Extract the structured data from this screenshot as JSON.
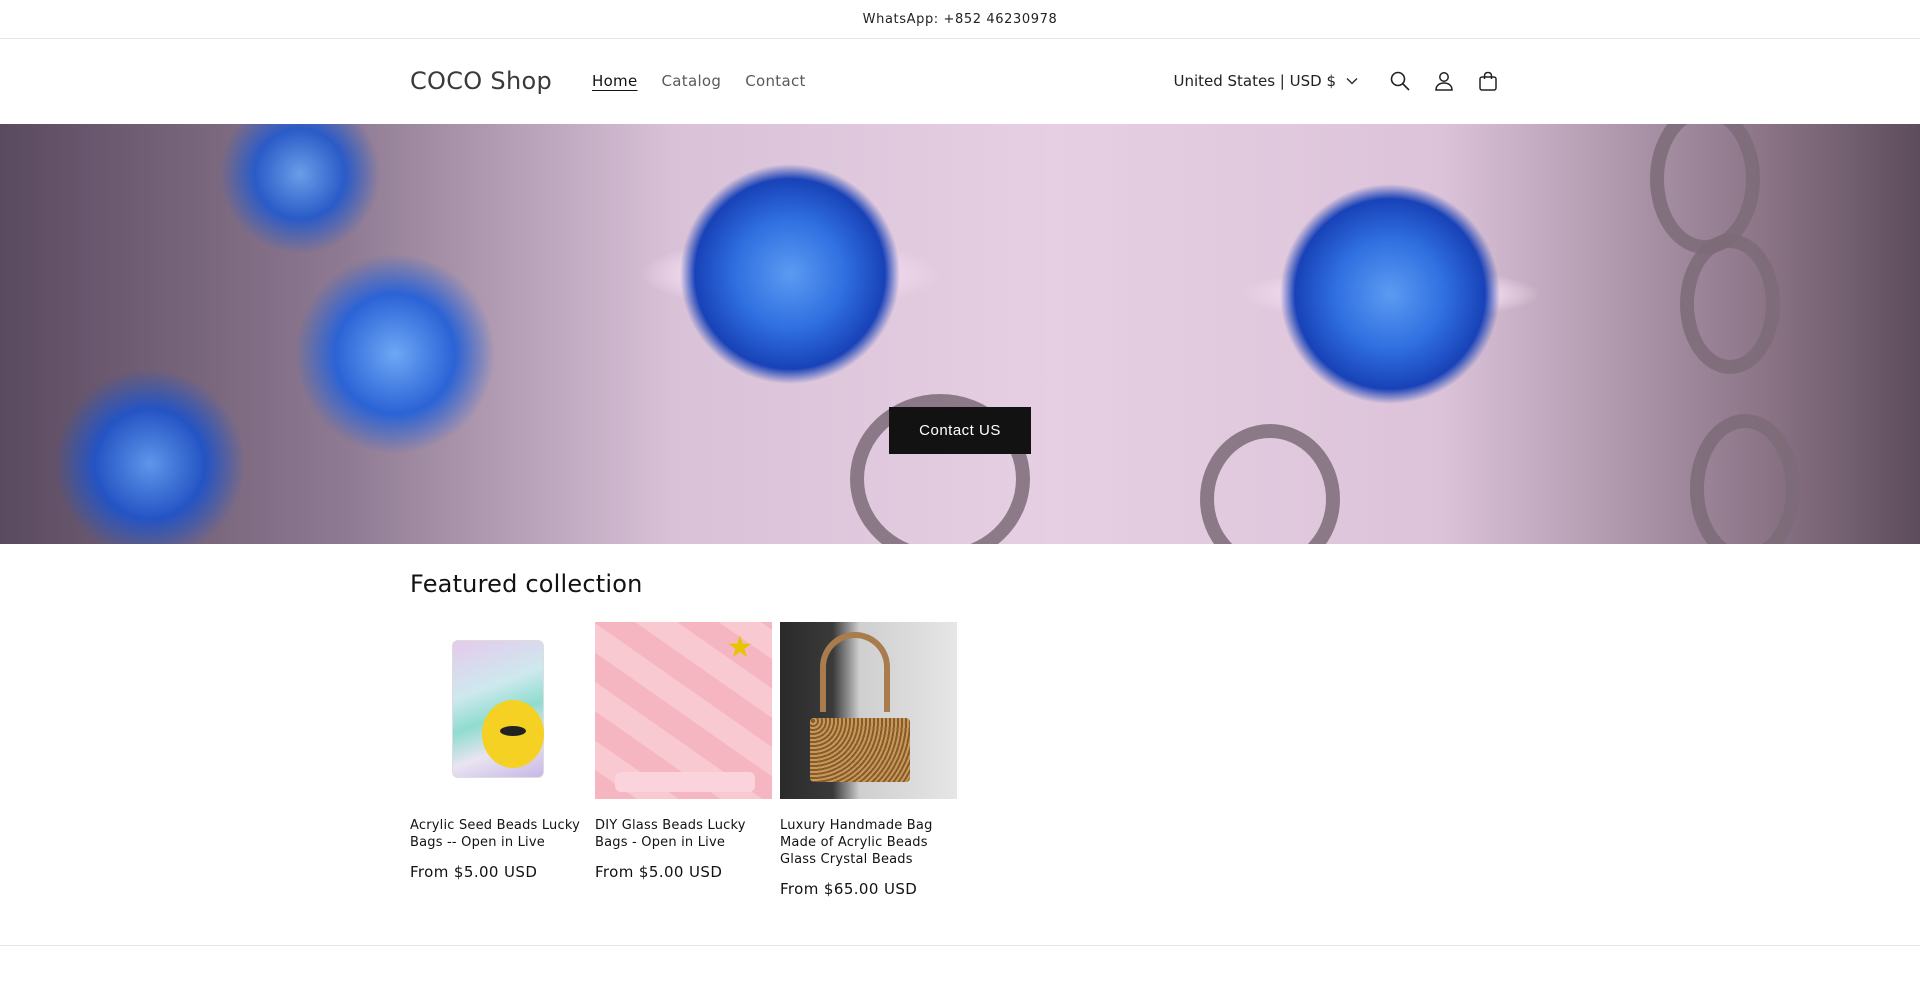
{
  "announcement": {
    "text": "WhatsApp: +852 46230978"
  },
  "header": {
    "logo": "COCO Shop",
    "nav": [
      {
        "label": "Home",
        "active": true
      },
      {
        "label": "Catalog",
        "active": false
      },
      {
        "label": "Contact",
        "active": false
      }
    ],
    "country_selector": "United States | USD $",
    "icons": [
      "search-icon",
      "account-icon",
      "cart-icon"
    ]
  },
  "banner": {
    "cta_label": "Contact US"
  },
  "featured": {
    "heading": "Featured collection",
    "products": [
      {
        "title": "Acrylic Seed Beads Lucky Bags -- Open in Live",
        "price": "From $5.00 USD"
      },
      {
        "title": "DIY Glass Beads Lucky Bags - Open in Live",
        "price": "From $5.00 USD"
      },
      {
        "title": "Luxury Handmade Bag Made of Acrylic Beads Glass Crystal Beads",
        "price": "From $65.00 USD"
      }
    ]
  },
  "colors": {
    "button_bg": "#121212",
    "text": "#121212",
    "border": "#e6e6e6"
  }
}
